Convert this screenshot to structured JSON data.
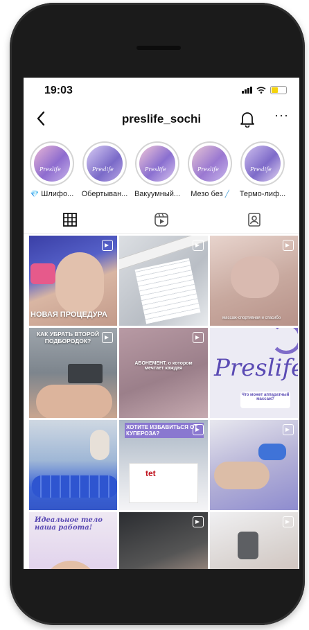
{
  "status": {
    "time": "19:03"
  },
  "header": {
    "username": "preslife_sochi",
    "more": "···"
  },
  "stories": [
    {
      "label": "Шлифо...",
      "brand": "Preslife"
    },
    {
      "label": "Обертыван...",
      "brand": "Preslife"
    },
    {
      "label": "Вакуумный...",
      "brand": "Preslife"
    },
    {
      "label": "Мезо без",
      "brand": "Preslife"
    },
    {
      "label": "Термо-лиф...",
      "brand": "Preslife"
    }
  ],
  "posts": [
    {
      "caption": "НОВАЯ ПРОЦЕДУРА"
    },
    {
      "caption": ""
    },
    {
      "caption": "массаж-спортивная и спасибо"
    },
    {
      "caption": "КАК УБРАТЬ ВТОРОЙ ПОДБОРОДОК?"
    },
    {
      "caption": "АБОНЕМЕНТ, о котором мечтает каждая"
    },
    {
      "caption": "Preslife",
      "sub": "Что может аппаратный массаж?"
    },
    {
      "caption": ""
    },
    {
      "caption": "ХОТИТЕ ИЗБАВИТЬСЯ ОТ КУПЕРОЗА?",
      "brand": "tet"
    },
    {
      "caption": ""
    },
    {
      "caption": "Идеальное тело наша работа!"
    },
    {
      "caption": ""
    },
    {
      "caption": ""
    }
  ],
  "colors": {
    "accent_battery": "#f4d30c",
    "story_gem": "#2b9ad8"
  },
  "icons": [
    "back-chevron-icon",
    "bell-icon",
    "more-dots-icon",
    "grid-icon",
    "reels-icon",
    "tagged-icon",
    "reel-badge-icon"
  ]
}
